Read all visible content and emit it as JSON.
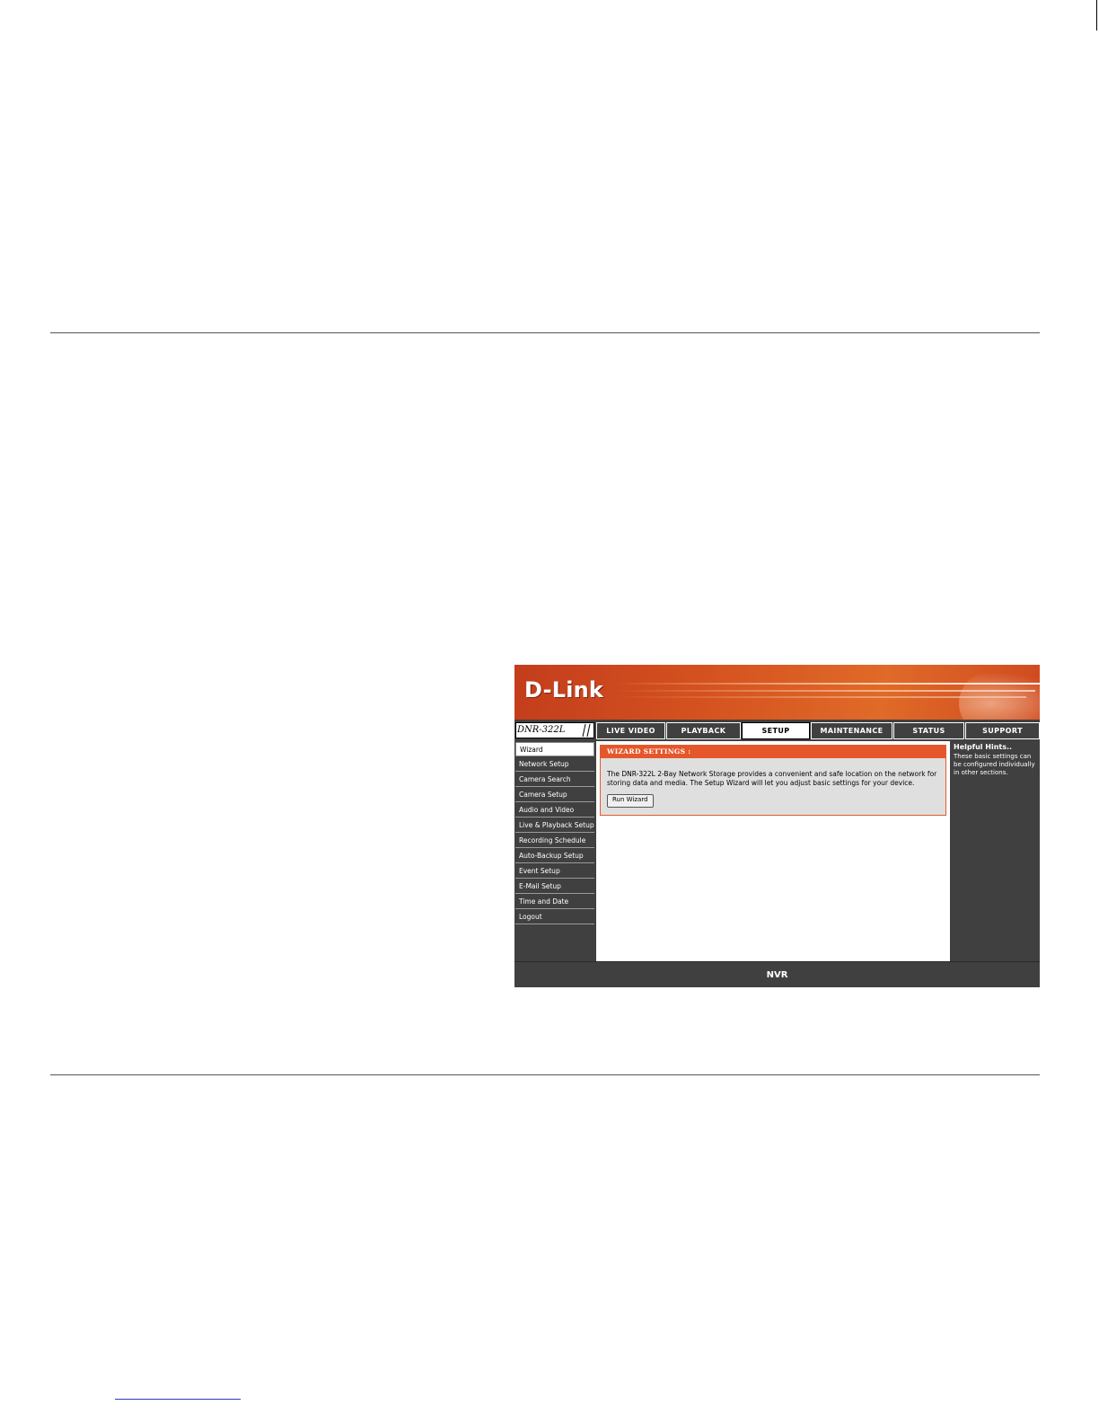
{
  "brand": {
    "logo_text": "D-Link"
  },
  "device": {
    "model": "DNR-322L"
  },
  "nav": {
    "tabs": [
      {
        "label": "LIVE VIDEO",
        "active": false
      },
      {
        "label": "PLAYBACK",
        "active": false
      },
      {
        "label": "SETUP",
        "active": true
      },
      {
        "label": "MAINTENANCE",
        "active": false
      },
      {
        "label": "STATUS",
        "active": false
      },
      {
        "label": "SUPPORT",
        "active": false
      }
    ]
  },
  "sidebar": {
    "items": [
      {
        "label": "Wizard",
        "active": true
      },
      {
        "label": "Network Setup"
      },
      {
        "label": "Camera Search"
      },
      {
        "label": "Camera Setup"
      },
      {
        "label": "Audio and Video"
      },
      {
        "label": "Live & Playback Setup"
      },
      {
        "label": "Recording Schedule"
      },
      {
        "label": "Auto-Backup Setup"
      },
      {
        "label": "Event Setup"
      },
      {
        "label": "E-Mail Setup"
      },
      {
        "label": "Time and Date"
      },
      {
        "label": "Logout"
      }
    ]
  },
  "wizard": {
    "heading": "WIZARD SETTINGS :",
    "description": "The DNR-322L 2-Bay Network Storage provides a convenient and safe location on the network for storing data and media. The Setup Wizard will let you adjust basic settings for your device.",
    "run_button": "Run Wizard"
  },
  "hints": {
    "title": "Helpful Hints..",
    "body": "These basic settings can be configured individually in other sections."
  },
  "footer": {
    "label": "NVR"
  },
  "colors": {
    "accent": "#e5562b",
    "dark_panel": "#404040",
    "content_bg": "#dfdfdf"
  }
}
